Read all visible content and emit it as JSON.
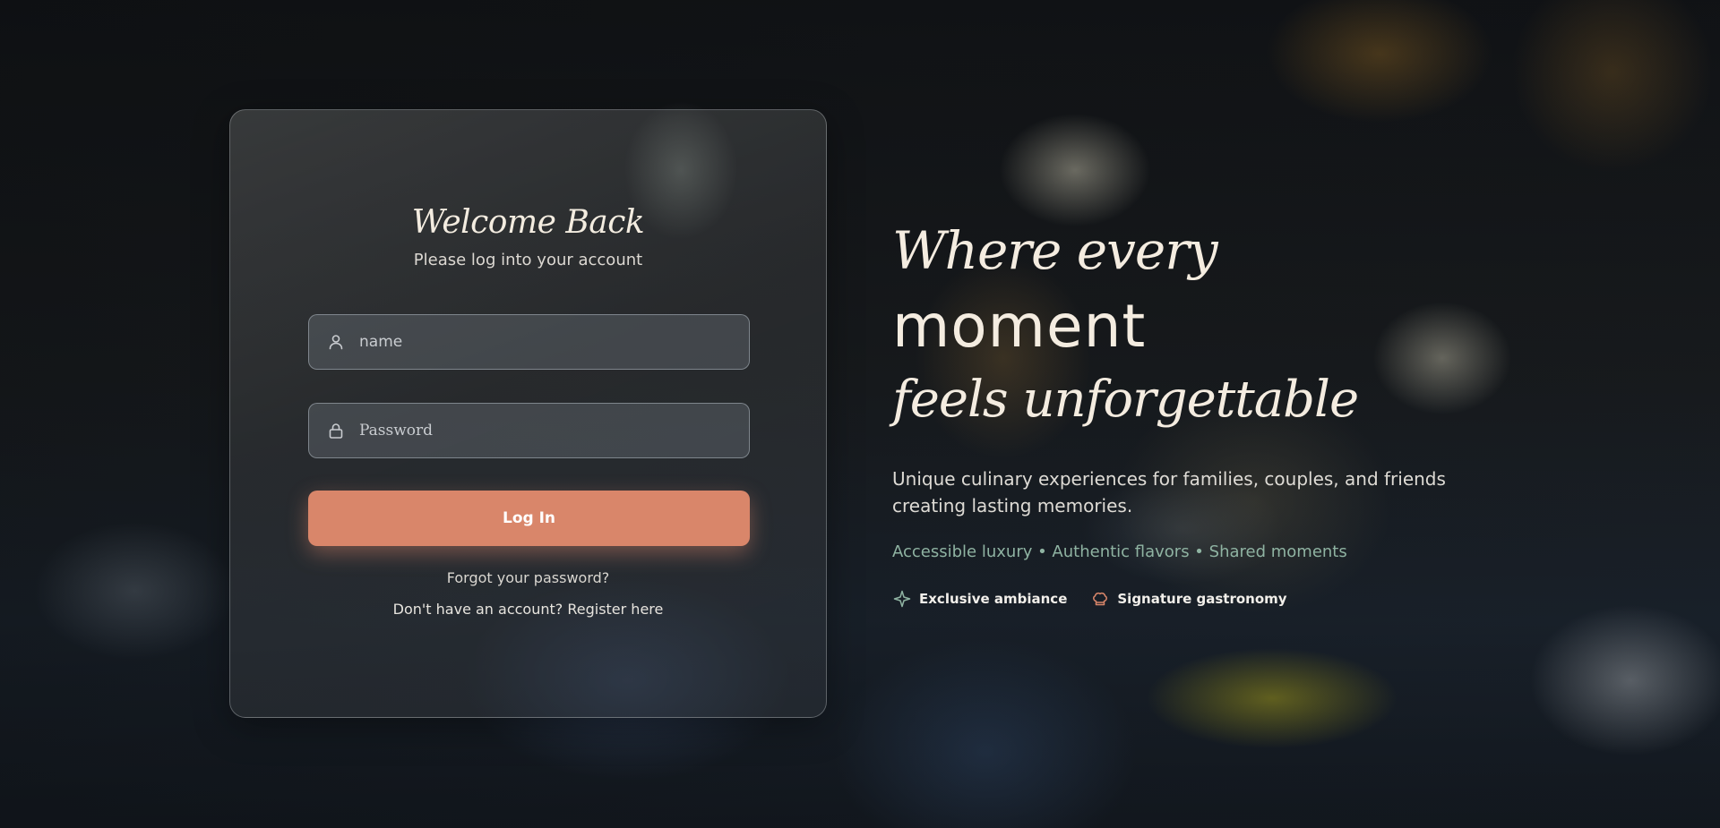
{
  "login": {
    "title": "Welcome Back",
    "subtitle": "Please log into your account",
    "name_placeholder": "name",
    "password_placeholder": "Password",
    "login_label": "Log In",
    "forgot_link": "Forgot your password?",
    "register_link": "Don't have an account? Register here",
    "icons": {
      "name": "user-icon",
      "password": "lock-icon"
    }
  },
  "hero": {
    "line1": "Where every",
    "line2": "moment",
    "line3": "feels unforgettable",
    "description": "Unique culinary experiences for families, couples, and friends creating lasting memories.",
    "tagline": "Accessible luxury • Authentic flavors • Shared moments",
    "features": [
      {
        "label": "Exclusive ambiance",
        "icon": "sparkle-icon"
      },
      {
        "label": "Signature gastronomy",
        "icon": "chef-hat-icon"
      }
    ]
  },
  "colors": {
    "accent": "#d9866a",
    "tagline": "#8fb3a2",
    "heading": "#f4ece0"
  }
}
